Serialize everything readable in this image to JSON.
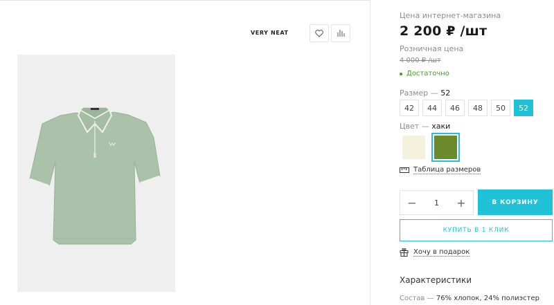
{
  "product": {
    "brand": "VERY NEAT",
    "image_alt": "polo shirt",
    "colors_main": {
      "photo_bg": "#efefef",
      "shirt": "#a9c2a9",
      "shirt_trim": "#f3f1e6"
    }
  },
  "actions": {
    "favorite_icon": "heart-icon",
    "compare_icon": "bar-chart-icon"
  },
  "pricing": {
    "online_label": "Цена интернет-магазина",
    "online_price": "2 200 ₽ /шт",
    "retail_label": "Розничная цена",
    "retail_price": "4 000 ₽ /шт",
    "stock": "Достаточно"
  },
  "size": {
    "label": "Размер",
    "dash": "—",
    "selected": "52",
    "options": [
      "42",
      "44",
      "46",
      "48",
      "50",
      "52"
    ]
  },
  "color": {
    "label": "Цвет",
    "dash": "—",
    "selected": "хаки",
    "swatches": [
      {
        "hex": "#f4f2dc",
        "active": false
      },
      {
        "hex": "#6b8a2b",
        "active": true
      }
    ]
  },
  "size_table": {
    "label": "Таблица размеров",
    "icon": "ruler-icon"
  },
  "quantity": {
    "minus": "−",
    "value": "1",
    "plus": "+"
  },
  "buttons": {
    "add_to_cart": "В КОРЗИНУ",
    "buy_one_click": "КУПИТЬ В 1 КЛИК"
  },
  "gift": {
    "label": "Хочу в подарок",
    "icon": "gift-icon"
  },
  "characteristics": {
    "title": "Характеристики",
    "composition_label": "Состав",
    "dash": "—",
    "composition_value": "76% хлопок, 24% полиэстер"
  },
  "accent_color": "#1fc2d6"
}
